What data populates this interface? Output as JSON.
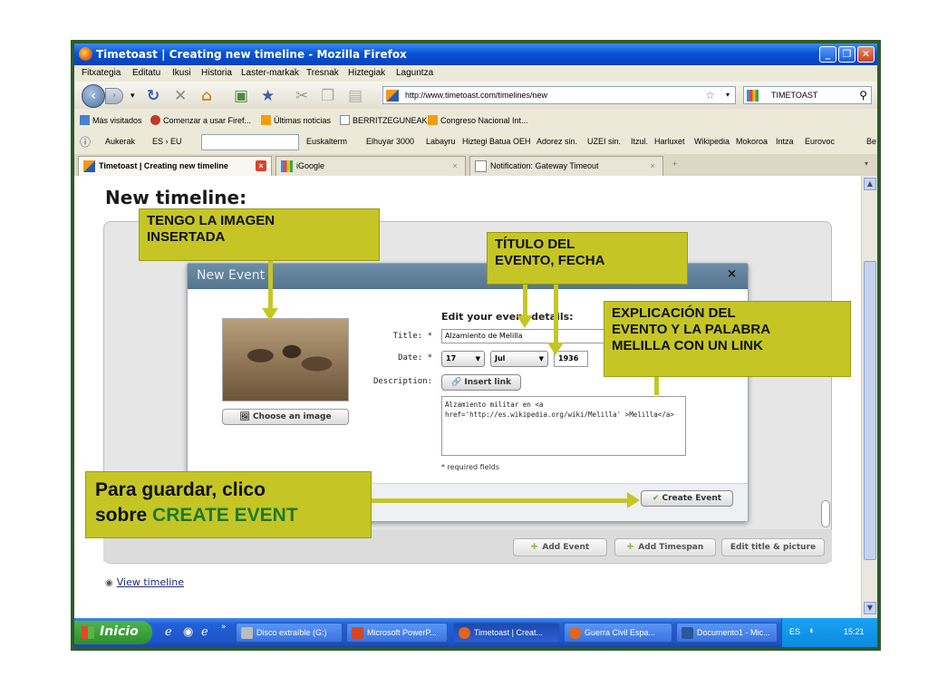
{
  "window": {
    "title": "Timetoast | Creating new timeline - Mozilla Firefox",
    "controls": [
      "_",
      "❐",
      "✕"
    ]
  },
  "menu": [
    "Fitxategia",
    "Editatu",
    "Ikusi",
    "Historia",
    "Laster-markak",
    "Tresnak",
    "Hiztegiak",
    "Laguntza"
  ],
  "nav": {
    "url": "http://www.timetoast.com/timelines/new",
    "search_value": "TIMETOAST"
  },
  "bookmarks": [
    "Más visitados",
    "Comenzar a usar Firef...",
    "Últimas noticias",
    "BERRITZEGUNEAK",
    "Congreso Nacional Int..."
  ],
  "toolbar2": {
    "items": [
      "Aukerak",
      "ES › EU",
      "Euskalterm",
      "Elhuyar 3000",
      "Labayru",
      "Hiztegi Batua",
      "OEH",
      "Adorez sin.",
      "UZEI sin.",
      "Itzul.",
      "Harluxet",
      "Wikipedia",
      "Mokoroa",
      "Intza",
      "Eurovoc",
      "Be"
    ]
  },
  "tabs": [
    {
      "label": "Timetoast | Creating new timeline"
    },
    {
      "label": "iGoogle"
    },
    {
      "label": "Notification: Gateway Timeout"
    }
  ],
  "page": {
    "heading": "New timeline:",
    "view_timeline": "View timeline",
    "buttons": {
      "add_event": "Add Event",
      "add_timespan": "Add Timespan",
      "edit_title": "Edit title & picture"
    }
  },
  "modal": {
    "title": "New Event",
    "close": "×",
    "choose_image": "Choose an image",
    "edit_heading": "Edit your event details:",
    "labels": {
      "title": "Title: *",
      "date": "Date: *",
      "description": "Description:"
    },
    "title_value": "Alzamiento de Melilla",
    "day": "17",
    "month": "Jul",
    "year": "1936",
    "insert_link": "Insert link",
    "description_value": "Alzamiento militar en <a href='http://es.wikipedia.org/wiki/Melilla' >Melilla</a>",
    "required_note": "* required fields",
    "create_button": "Create Event"
  },
  "annotations": {
    "image": "TENGO LA IMAGEN\nINSERTADA",
    "title_date": "TÍTULO DEL\nEVENTO, FECHA",
    "explanation": "EXPLICACIÓN DEL\nEVENTO Y LA PALABRA\nMELILLA CON UN LINK",
    "save_line1": "Para guardar, clico",
    "save_line2_prefix": "sobre ",
    "save_line2_emphasis": "CREATE EVENT"
  },
  "taskbar": {
    "start": "Inicio",
    "items": [
      "Disco extraíble (G:)",
      "Microsoft PowerP...",
      "Timetoast | Creat...",
      "Guerra Civil Espa...",
      "Documento1 - Mic..."
    ],
    "lang": "ES",
    "clock": "15:21"
  },
  "colors": {
    "annotation": "#c5c626",
    "emphasis_green": "#1c7a24",
    "titlebar": "#0a53d6",
    "frame": "#2d5b2b"
  }
}
